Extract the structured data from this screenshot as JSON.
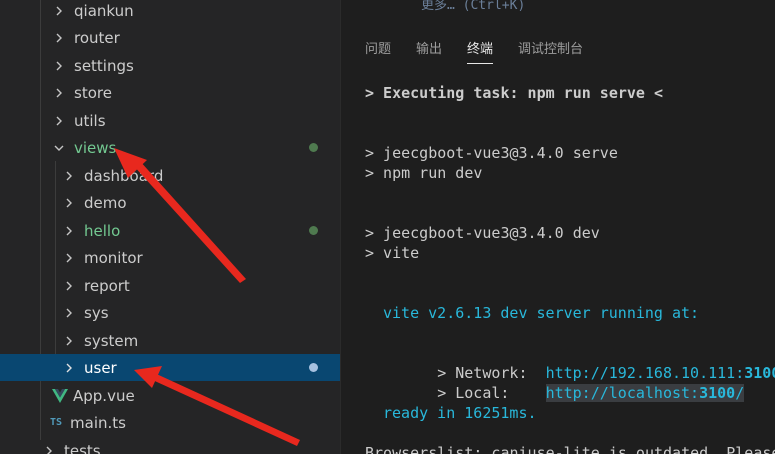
{
  "explorer": {
    "items": [
      {
        "label": "qiankun",
        "kind": "folder"
      },
      {
        "label": "router",
        "kind": "folder"
      },
      {
        "label": "settings",
        "kind": "folder"
      },
      {
        "label": "store",
        "kind": "folder"
      },
      {
        "label": "utils",
        "kind": "folder"
      },
      {
        "label": "views",
        "kind": "folder-open",
        "modified": true
      },
      {
        "label": "dashboard",
        "kind": "folder"
      },
      {
        "label": "demo",
        "kind": "folder"
      },
      {
        "label": "hello",
        "kind": "folder",
        "modified": true
      },
      {
        "label": "monitor",
        "kind": "folder"
      },
      {
        "label": "report",
        "kind": "folder"
      },
      {
        "label": "sys",
        "kind": "folder"
      },
      {
        "label": "system",
        "kind": "folder"
      },
      {
        "label": "user",
        "kind": "folder",
        "selected": true,
        "modified": true
      },
      {
        "label": "App.vue",
        "kind": "vue-file"
      },
      {
        "label": "main.ts",
        "kind": "ts-file",
        "icon_text": "TS"
      },
      {
        "label": "tests",
        "kind": "folder"
      }
    ]
  },
  "panel": {
    "top_partial_text": "更多… (Ctrl+K)",
    "tabs": [
      {
        "label": "问题"
      },
      {
        "label": "输出"
      },
      {
        "label": "终端",
        "active": true
      },
      {
        "label": "调试控制台"
      }
    ],
    "terminal": {
      "task_line": "> Executing task: npm run serve <",
      "line_serve_1": "> jeecgboot-vue3@3.4.0 serve",
      "line_serve_2": "> npm run dev",
      "line_dev_1": "> jeecgboot-vue3@3.4.0 dev",
      "line_dev_2": "> vite",
      "vite_running": "vite v2.6.13 dev server running at:",
      "network_label": "> Network:  ",
      "network_url_prefix": "http://192.168.10.111:",
      "network_port": "3100",
      "network_url_suffix": "/",
      "local_label": "> Local:    ",
      "local_url_prefix": "http://localhost:",
      "local_port": "3100",
      "local_url_suffix": "/",
      "ready": "ready in 16251ms.",
      "browserslist_partial": "Browserslist: caniuse-lite is outdated. Please"
    }
  },
  "colors": {
    "sidebar_bg": "#252526",
    "editor_bg": "#1e1e1e",
    "selection_bg": "#094771",
    "git_green": "#73c991",
    "terminal_cyan": "#29b8db",
    "arrow_red": "#e8281e"
  }
}
